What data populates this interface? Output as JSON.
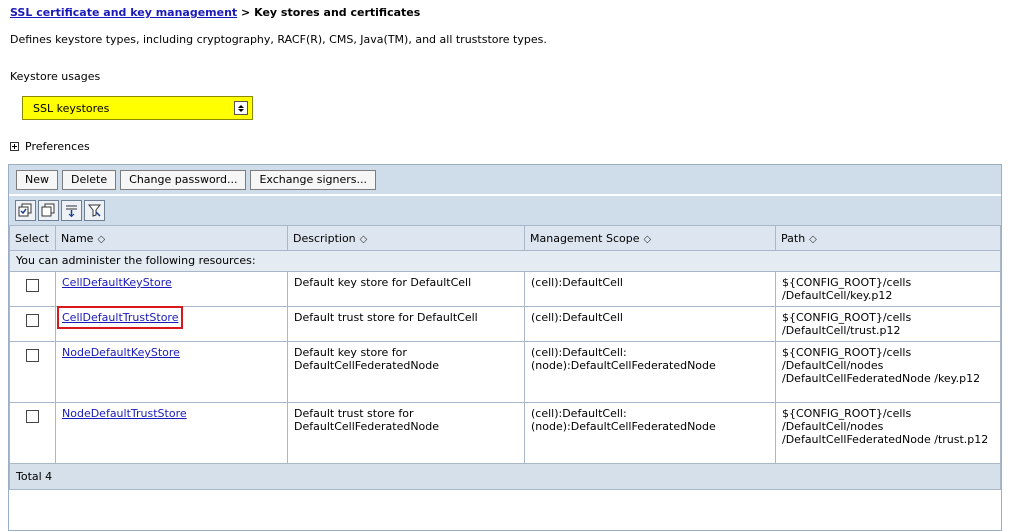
{
  "breadcrumb": {
    "parent": "SSL certificate and key management",
    "separator": ">",
    "current": "Key stores and certificates"
  },
  "description": "Defines keystore types, including cryptography, RACF(R), CMS, Java(TM), and all truststore types.",
  "keystore_usages": {
    "label": "Keystore usages",
    "selected": "SSL keystores",
    "highlight_color": "#ffff00"
  },
  "preferences": {
    "label": "Preferences",
    "icon": "plus-box-icon"
  },
  "toolbar": {
    "buttons": [
      "New",
      "Delete",
      "Change password...",
      "Exchange signers..."
    ],
    "icons": [
      "select-all-icon",
      "deselect-all-icon",
      "show-filter-icon",
      "clear-filter-icon"
    ]
  },
  "table": {
    "headers": {
      "select": "Select",
      "name": "Name",
      "description": "Description",
      "scope": "Management Scope",
      "path": "Path"
    },
    "group_label": "You can administer the following resources:",
    "rows": [
      {
        "name": "CellDefaultKeyStore",
        "description": "Default key store for DefaultCell",
        "scope": "(cell):DefaultCell",
        "path": "${CONFIG_ROOT}/cells /DefaultCell/key.p12"
      },
      {
        "name": "CellDefaultTrustStore",
        "description": "Default trust store for DefaultCell",
        "scope": "(cell):DefaultCell",
        "path": "${CONFIG_ROOT}/cells /DefaultCell/trust.p12",
        "highlighted": true
      },
      {
        "name": "NodeDefaultKeyStore",
        "description": "Default key store for DefaultCellFederatedNode",
        "scope": "(cell):DefaultCell: (node):DefaultCellFederatedNode",
        "path": "${CONFIG_ROOT}/cells /DefaultCell/nodes /DefaultCellFederatedNode /key.p12"
      },
      {
        "name": "NodeDefaultTrustStore",
        "description": "Default trust store for DefaultCellFederatedNode",
        "scope": "(cell):DefaultCell: (node):DefaultCellFederatedNode",
        "path": "${CONFIG_ROOT}/cells /DefaultCell/nodes /DefaultCellFederatedNode /trust.p12"
      }
    ],
    "total": "Total 4"
  }
}
